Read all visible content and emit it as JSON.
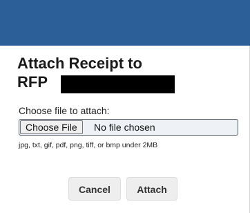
{
  "dialog": {
    "title_line1": "Attach Receipt to",
    "title_line2": "RFP",
    "choose_label": "Choose file to attach:",
    "file_input": {
      "button_label": "Choose File",
      "status_text": "No file chosen"
    },
    "hint": "jpg, txt, gif, pdf, png, tiff, or bmp under 2MB",
    "buttons": {
      "cancel_label": "Cancel",
      "attach_label": "Attach"
    }
  },
  "colors": {
    "header_bar": "#2c5f97",
    "redaction": "#000000"
  }
}
